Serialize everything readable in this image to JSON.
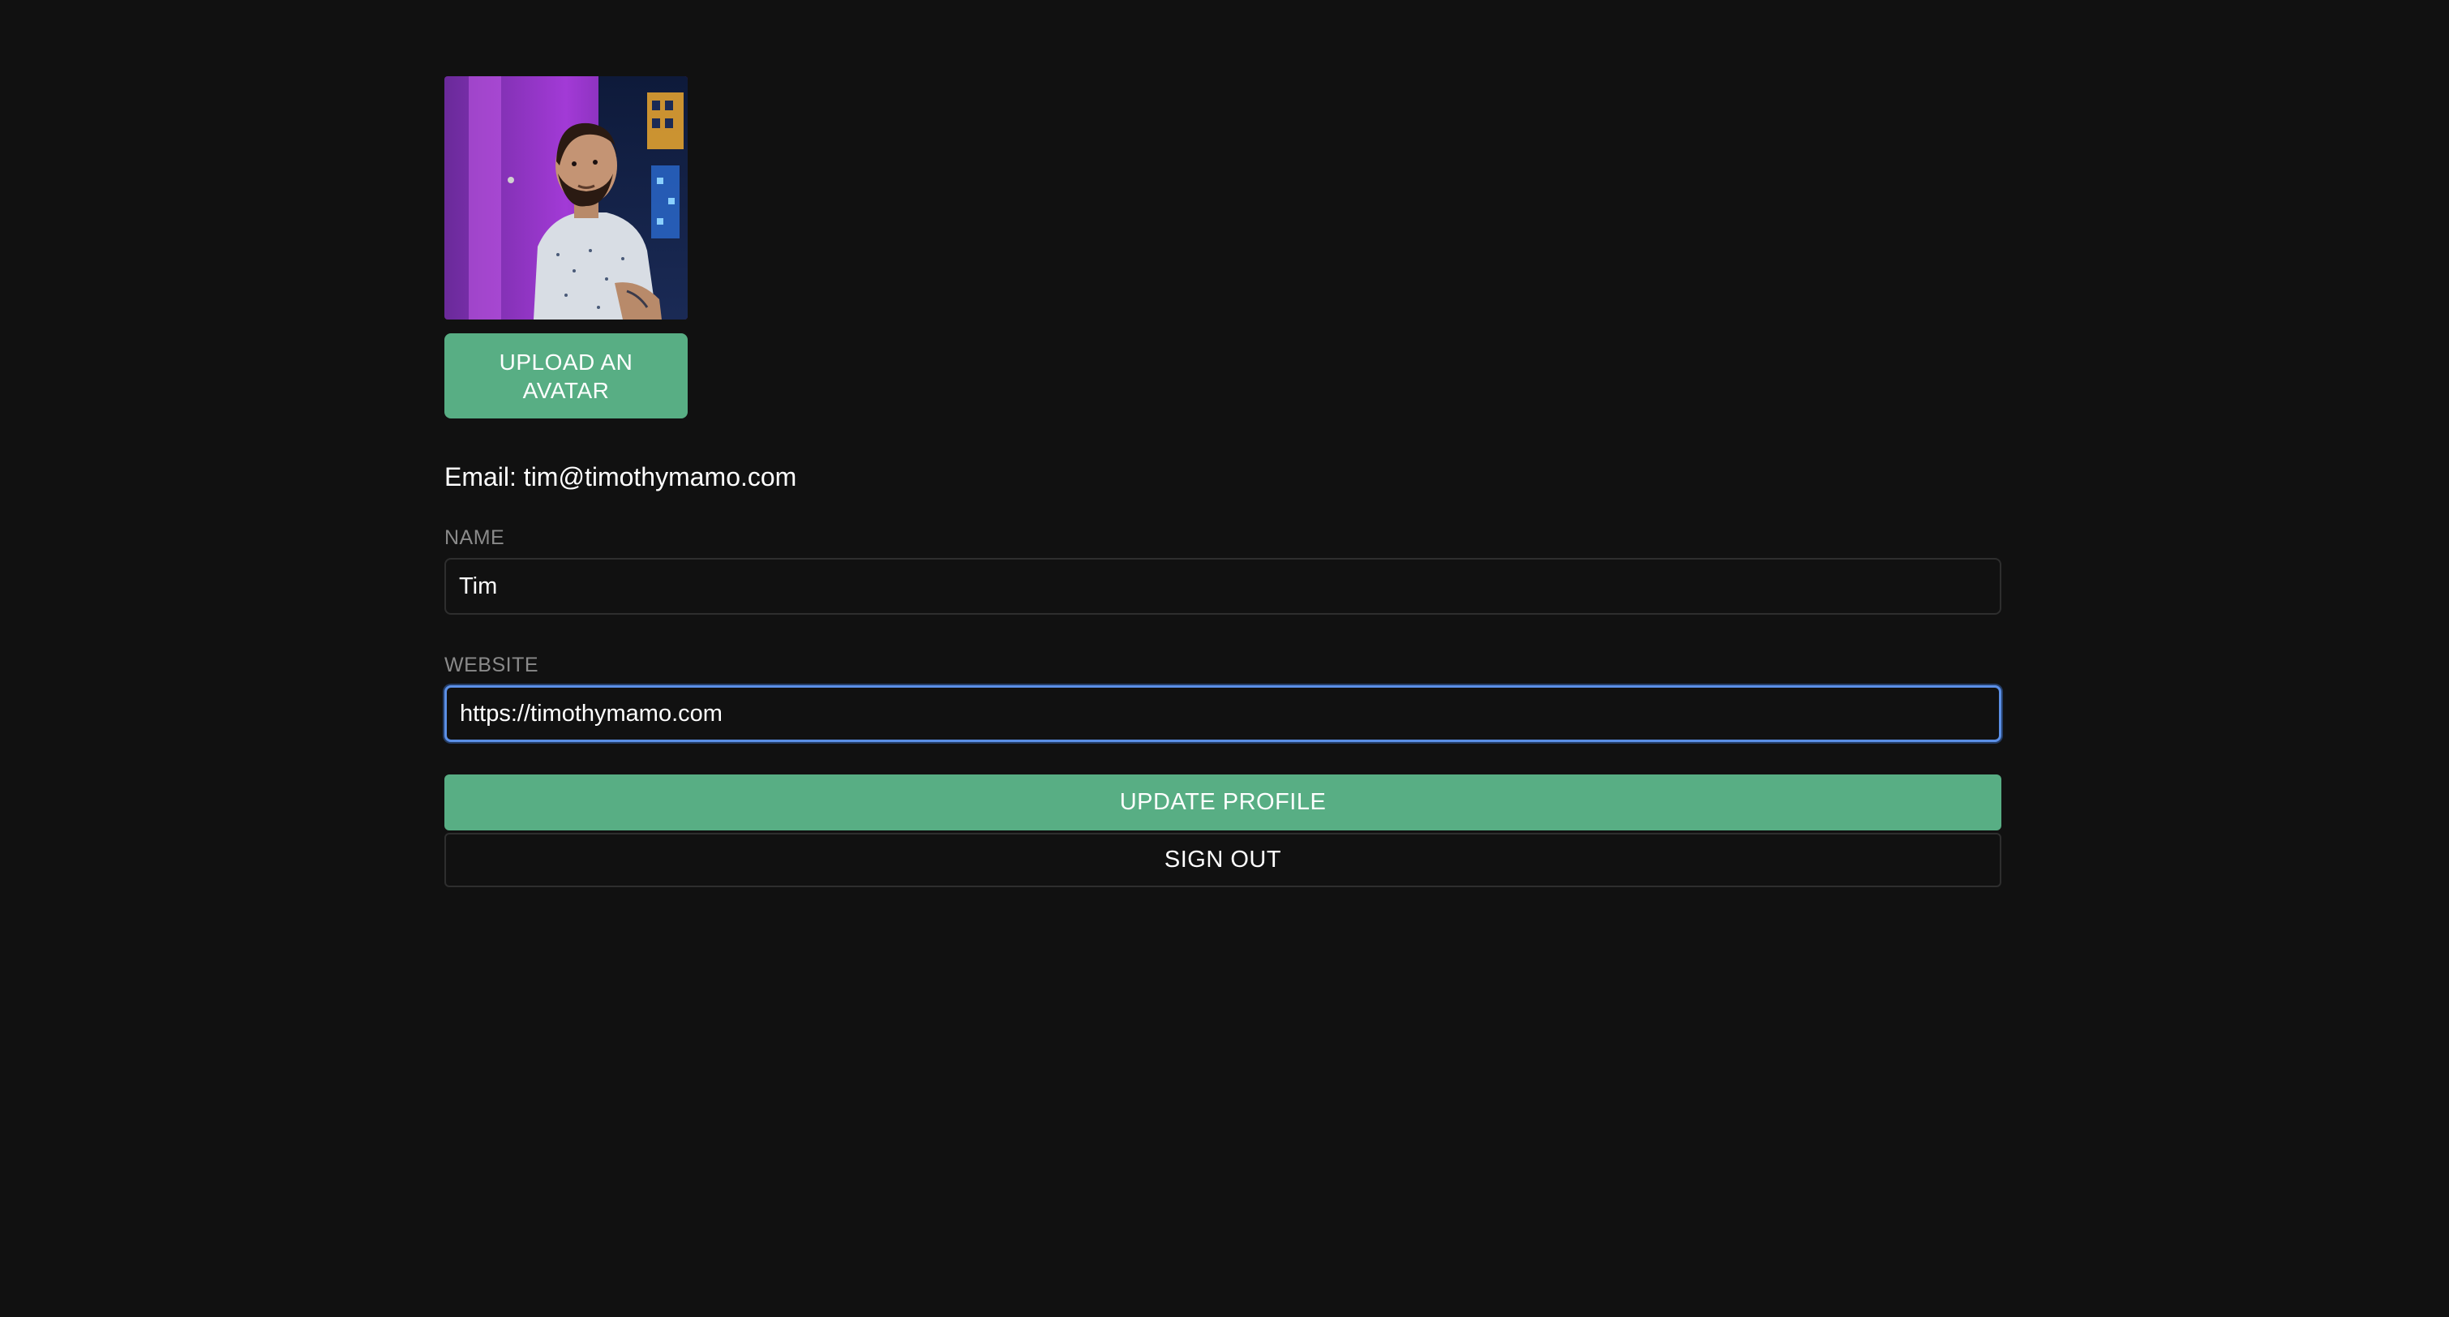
{
  "avatar": {
    "alt": "Avatar"
  },
  "upload": {
    "label": "UPLOAD AN AVATAR"
  },
  "account": {
    "email_prefix": "Email: ",
    "email": "tim@timothymamo.com"
  },
  "form": {
    "name_label": "NAME",
    "name_value": "Tim",
    "website_label": "WEBSITE",
    "website_value": "https://timothymamo.com"
  },
  "actions": {
    "update_label": "UPDATE PROFILE",
    "signout_label": "SIGN OUT"
  },
  "colors": {
    "background": "#111111",
    "accent_green": "#58ae84",
    "focus_blue": "#5b8fe6",
    "border": "#2e2e2e",
    "label_gray": "#8a8a8a"
  }
}
